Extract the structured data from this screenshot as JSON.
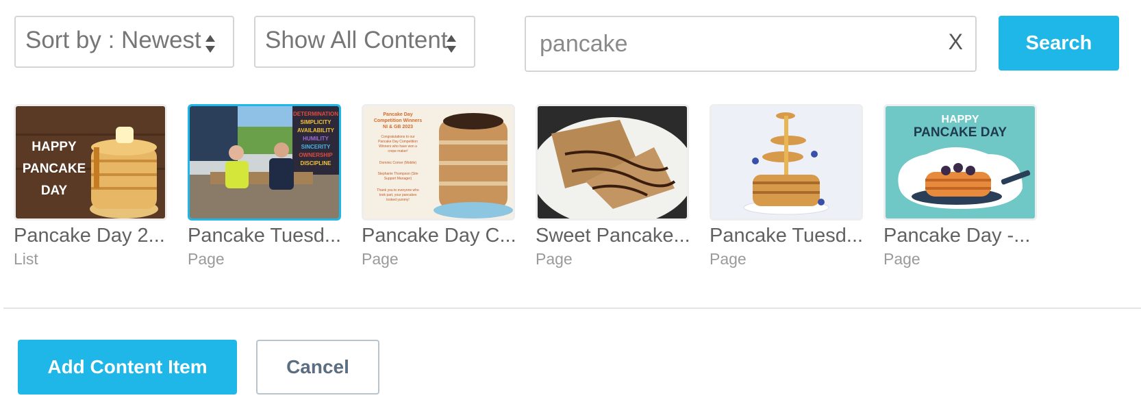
{
  "filters": {
    "sort": {
      "label": "Sort by : Newest",
      "icon": "sort-arrows-icon"
    },
    "content_type": {
      "label": "Show All Content",
      "icon": "sort-arrows-icon"
    }
  },
  "search": {
    "value": "pancake",
    "clear_label": "X",
    "button_label": "Search"
  },
  "results": [
    {
      "title": "Pancake Day 2...",
      "type": "List",
      "image_text": [
        "HAPPY",
        "PANCAKE",
        "DAY"
      ]
    },
    {
      "title": "Pancake Tuesd...",
      "type": "Page",
      "selected": true,
      "image_text": [
        "DETERMINATION",
        "SIMPLICITY",
        "AVAILABILITY",
        "HUMILITY",
        "SINCERITY",
        "OWNERSHIP",
        "DISCIPLINE"
      ]
    },
    {
      "title": "Pancake Day C...",
      "type": "Page",
      "image_text": [
        "Pancake Day",
        "Competition Winners",
        "NI & GB 2023",
        "Congratulations to our",
        "Pancake Day Competition",
        "Winners who have won a",
        "crepe maker!",
        "Dominic Corner (Mobile)",
        "Stephanie Thompson (Site",
        "Support Manager)",
        "Thank you to everyone who",
        "took part, your pancakes",
        "looked yummy!"
      ]
    },
    {
      "title": "Sweet Pancake...",
      "type": "Page"
    },
    {
      "title": "Pancake Tuesd...",
      "type": "Page"
    },
    {
      "title": "Pancake Day -...",
      "type": "Page",
      "image_text": [
        "HAPPY",
        "PANCAKE DAY"
      ]
    }
  ],
  "actions": {
    "add_label": "Add Content Item",
    "cancel_label": "Cancel"
  },
  "colors": {
    "accent": "#1fb6e8",
    "cancel_text": "#5b6d80"
  }
}
